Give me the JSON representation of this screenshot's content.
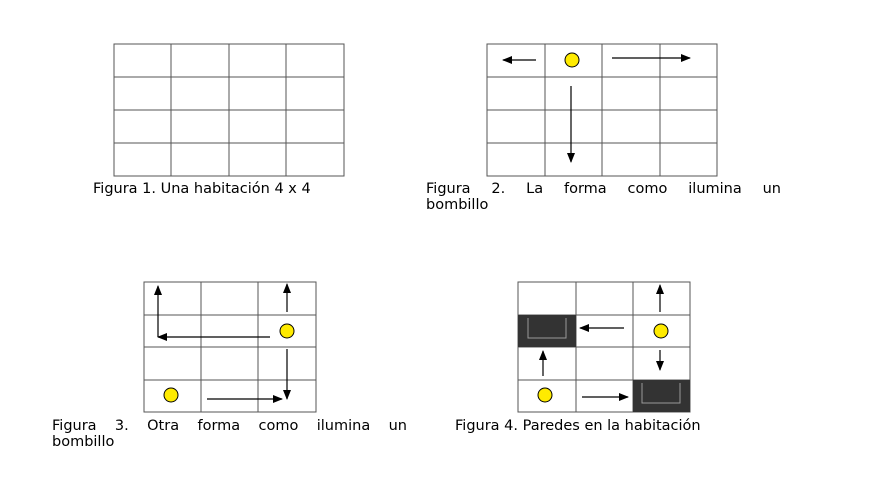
{
  "figures": {
    "fig1": {
      "caption": "Figura 1. Una habitación 4 x 4"
    },
    "fig2": {
      "caption_line1": "Figura 2. La forma como ilumina un",
      "caption_line2": "bombillo"
    },
    "fig3": {
      "caption_line1": "Figura 3. Otra forma como ilumina un",
      "caption_line2": "bombillo"
    },
    "fig4": {
      "caption": "Figura 4. Paredes en la habitación"
    }
  },
  "colors": {
    "grid_line": "#555555",
    "bulb_fill": "#FFEB00",
    "wall_fill": "#333333",
    "arrow": "#000000"
  }
}
